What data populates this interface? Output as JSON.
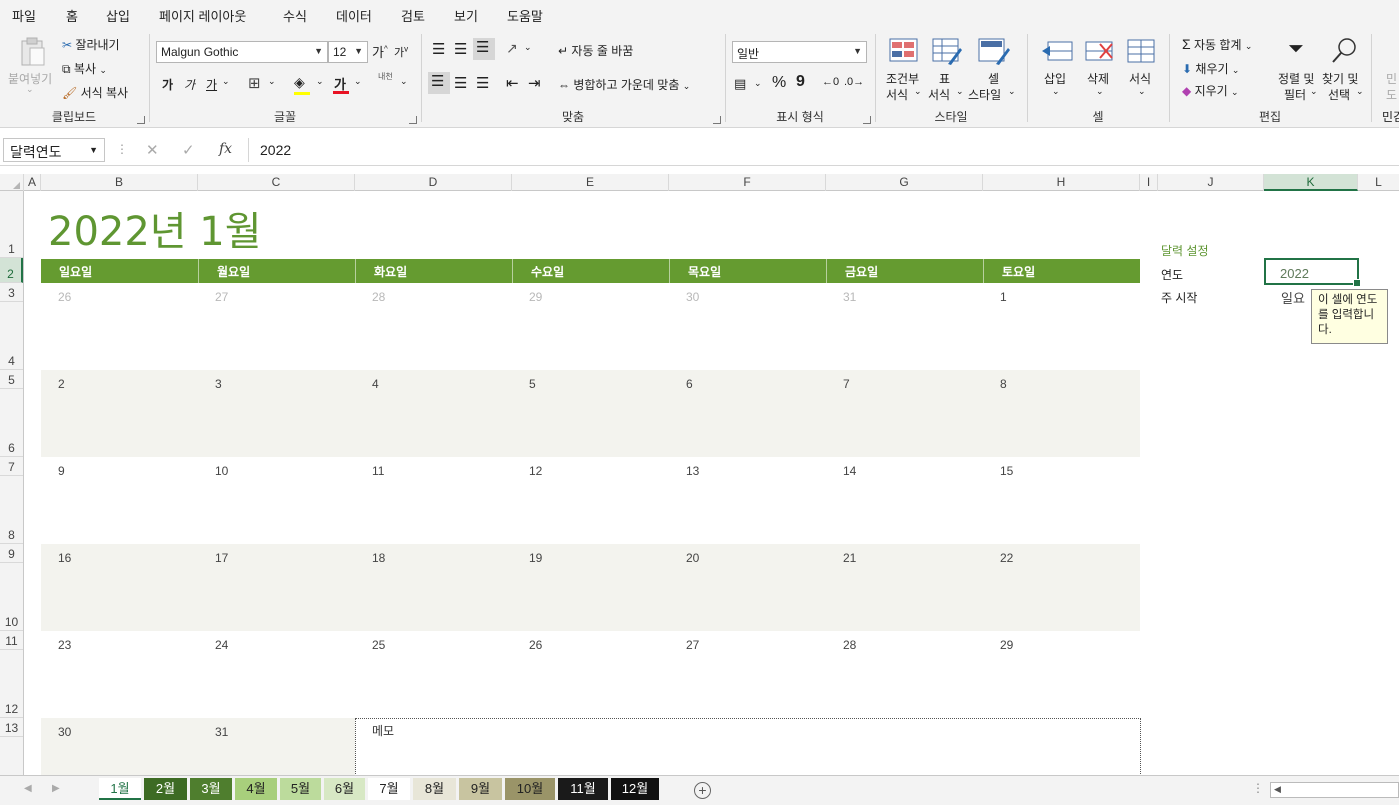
{
  "menu": {
    "tabs": [
      "파일",
      "홈",
      "삽입",
      "페이지 레이아웃",
      "수식",
      "데이터",
      "검토",
      "보기",
      "도움말"
    ],
    "active": "홈"
  },
  "ribbon": {
    "clipboard": {
      "paste": "붙여넣기",
      "cut": "잘라내기",
      "copy": "복사",
      "format_painter": "서식 복사",
      "label": "클립보드"
    },
    "font": {
      "name": "Malgun Gothic",
      "size": "12",
      "grow": "가",
      "shrink": "가",
      "bold": "가",
      "italic": "가",
      "underline": "가",
      "font_color": "가",
      "phonetic": "내천",
      "label": "글꼴",
      "font_color_hex": "#e81123"
    },
    "alignment": {
      "wrap_text": "자동 줄 바꿈",
      "merge_center": "병합하고 가운데 맞춤",
      "label": "맞춤"
    },
    "number": {
      "format": "일반",
      "percent": "%",
      "comma": "9",
      "label": "표시 형식"
    },
    "styles": {
      "conditional": "조건부",
      "conditional2": "서식",
      "table": "표",
      "table2": "서식",
      "cell": "셀",
      "cell2": "스타일",
      "label": "스타일"
    },
    "cells": {
      "insert": "삽입",
      "delete": "삭제",
      "format": "서식",
      "label": "셀"
    },
    "editing": {
      "autosum": "자동 합계",
      "fill": "채우기",
      "clear": "지우기",
      "sort": "정렬 및",
      "sort2": "필터",
      "find": "찾기 및",
      "find2": "선택",
      "label": "편집"
    },
    "partial": {
      "top": "민",
      "bottom": "도",
      "label": "민김"
    }
  },
  "formula_bar": {
    "name_box": "달력연도",
    "cancel": "✕",
    "enter": "✓",
    "fx": "fx",
    "value": "2022"
  },
  "columns": [
    "A",
    "B",
    "C",
    "D",
    "E",
    "F",
    "G",
    "H",
    "I",
    "J",
    "K",
    "L"
  ],
  "active_column": "K",
  "rows": [
    "1",
    "2",
    "3",
    "4",
    "5",
    "6",
    "7",
    "8",
    "9",
    "10",
    "11",
    "12",
    "13"
  ],
  "active_row": "2",
  "calendar": {
    "title": "2022년 1월",
    "weekdays": [
      "일요일",
      "월요일",
      "화요일",
      "수요일",
      "목요일",
      "금요일",
      "토요일"
    ],
    "weeks": [
      [
        "26",
        "27",
        "28",
        "29",
        "30",
        "31",
        "1"
      ],
      [
        "2",
        "3",
        "4",
        "5",
        "6",
        "7",
        "8"
      ],
      [
        "9",
        "10",
        "11",
        "12",
        "13",
        "14",
        "15"
      ],
      [
        "16",
        "17",
        "18",
        "19",
        "20",
        "21",
        "22"
      ],
      [
        "23",
        "24",
        "25",
        "26",
        "27",
        "28",
        "29"
      ],
      [
        "30",
        "31"
      ]
    ],
    "memo_label": "메모",
    "accent": "#659b30"
  },
  "settings": {
    "title": "달력 설정",
    "year_label": "연도",
    "year_value": "2022",
    "week_start_label": "주 시작",
    "week_start_value": "일요",
    "tooltip": "이 셀에 연도를 입력합니다."
  },
  "sheet_tabs": [
    {
      "label": "1월",
      "bg": "#ffffff",
      "fg": "#217346"
    },
    {
      "label": "2월",
      "bg": "#3d6b24",
      "fg": "#ffffff"
    },
    {
      "label": "3월",
      "bg": "#4f7e2e",
      "fg": "#ffffff"
    },
    {
      "label": "4월",
      "bg": "#a8cf7c",
      "fg": "#222222"
    },
    {
      "label": "5월",
      "bg": "#bcdb9c",
      "fg": "#222222"
    },
    {
      "label": "6월",
      "bg": "#d7e8c4",
      "fg": "#222222"
    },
    {
      "label": "7월",
      "bg": "#ffffff",
      "fg": "#222222"
    },
    {
      "label": "8월",
      "bg": "#e8e6d8",
      "fg": "#222222"
    },
    {
      "label": "9월",
      "bg": "#c8c4a0",
      "fg": "#222222"
    },
    {
      "label": "10월",
      "bg": "#9a9468",
      "fg": "#222222"
    },
    {
      "label": "11월",
      "bg": "#1a1a1a",
      "fg": "#ffffff"
    },
    {
      "label": "12월",
      "bg": "#111111",
      "fg": "#ffffff"
    }
  ],
  "add_sheet": "+"
}
